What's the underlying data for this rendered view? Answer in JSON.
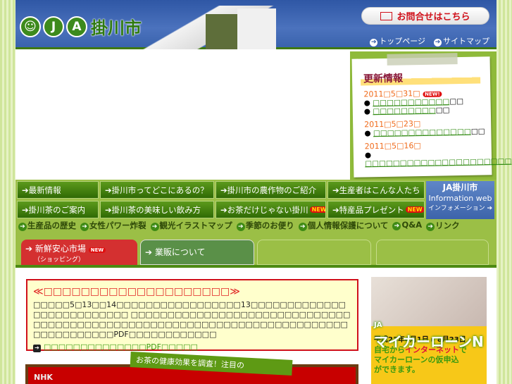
{
  "header": {
    "logo_letters": [
      "J",
      "A"
    ],
    "logo_text": "掛川市",
    "contact": "お問合せはこちら",
    "toplinks": [
      "トップページ",
      "サイトマップ"
    ]
  },
  "news": {
    "title": "更新情報",
    "new_badge": "NEW!",
    "entries": [
      {
        "date": "2011□5□31□",
        "items": [
          {
            "link": "□□□□□□□□□□□",
            "tail": "□□"
          },
          {
            "link": "□□□□□□□□□",
            "tail": "□□"
          }
        ]
      },
      {
        "date": "2011□5□23□",
        "items": [
          {
            "link": "□□□□□□□□□□□□□□",
            "tail": "□□"
          }
        ]
      },
      {
        "date": "2011□5□16□",
        "items": [
          {
            "link": "□□□□□□□□□□□□□□□□□□□□□",
            "tail": "□□"
          }
        ]
      }
    ]
  },
  "nav": {
    "row1": [
      "最新情報",
      "掛川市ってどこにあるの？",
      "掛川市の農作物のご紹介",
      "生産者はこんな人たち"
    ],
    "row2": [
      "掛川茶のご案内",
      "掛川茶の美味しい飲み方",
      "お茶だけじゃない掛川",
      "特産品プレゼント"
    ],
    "new_label": "NEW",
    "info": {
      "title": "JA掛川市",
      "sub": "Information web",
      "small": "インフォメーション"
    },
    "links": [
      "生産品の歴史",
      "女性パワー炸裂",
      "観光イラストマップ",
      "季節のお便り",
      "個人情報保護について",
      "Q&A",
      "リンク"
    ],
    "tabs": [
      {
        "label": "新鮮安心市場",
        "sub": "（ショッピング）",
        "badge": "NEW"
      },
      {
        "label": "業販について"
      }
    ]
  },
  "notice": {
    "title": "≪□□□□□□□□□□□□□□□□□□□□≫",
    "body": "□□□□□5□13□□14□□□□□□□□□□□□□□□□□13□□□□□□□□□□□□□□□□□□□□□□□□□□ □□□□□□□□□□□□□□□□□□□□□□□□□□□□□□□□□□□□□□□□□□□□□□□□□□□□□□□□□□□□□□□□□□□□□□□□□□□□□□□□□□□□PDF□□□□□□□□□□□□",
    "link": "□□□□□□□□□□□□□□PDF□□□□□"
  },
  "banner": {
    "strip": "お茶の健康効果を調査！注目の",
    "nhk": "NHK"
  },
  "ad": {
    "ja": "JA",
    "title": "マイカーローンN",
    "period": "平成23年4月1日 ▸ 8月23日",
    "line1a": "自宅から",
    "line1b": "インターネット",
    "line1c": "で",
    "line2": "マイカーローンの仮申込",
    "line3": "ができます。"
  }
}
